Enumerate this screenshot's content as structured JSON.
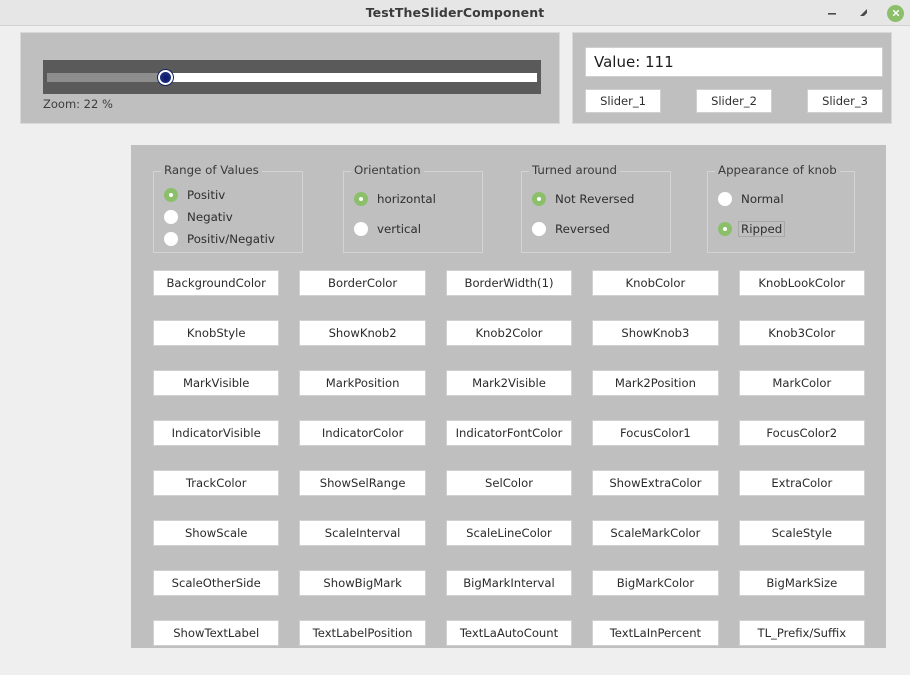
{
  "window": {
    "title": "TestTheSliderComponent",
    "controls": {
      "minimize": "minimize-icon",
      "maximize": "maximize-icon",
      "close": "close-icon"
    }
  },
  "slider_panel": {
    "zoom_label": "Zoom:  22  %",
    "zoom_percent": 22,
    "knob_position_percent": 22,
    "orientation": "horizontal"
  },
  "value_panel": {
    "value_text": "Value: 111",
    "value": 111,
    "buttons": [
      "Slider_1",
      "Slider_2",
      "Slider_3"
    ]
  },
  "option_groups": [
    {
      "legend": "Range of Values",
      "options": [
        {
          "label": "Positiv",
          "checked": true,
          "focused": false
        },
        {
          "label": "Negativ",
          "checked": false,
          "focused": false
        },
        {
          "label": "Positiv/Negativ",
          "checked": false,
          "focused": false
        }
      ]
    },
    {
      "legend": "Orientation",
      "options": [
        {
          "label": "horizontal",
          "checked": true,
          "focused": false
        },
        {
          "label": "vertical",
          "checked": false,
          "focused": false
        }
      ]
    },
    {
      "legend": "Turned around",
      "options": [
        {
          "label": "Not Reversed",
          "checked": true,
          "focused": false
        },
        {
          "label": "Reversed",
          "checked": false,
          "focused": false
        }
      ]
    },
    {
      "legend": "Appearance of knob",
      "options": [
        {
          "label": "Normal",
          "checked": false,
          "focused": false
        },
        {
          "label": "Ripped",
          "checked": true,
          "focused": true
        }
      ]
    }
  ],
  "property_buttons": [
    "BackgroundColor",
    "BorderColor",
    "BorderWidth(1)",
    "KnobColor",
    "KnobLookColor",
    "KnobStyle",
    "ShowKnob2",
    "Knob2Color",
    "ShowKnob3",
    "Knob3Color",
    "MarkVisible",
    "MarkPosition",
    "Mark2Visible",
    "Mark2Position",
    "MarkColor",
    "IndicatorVisible",
    "IndicatorColor",
    "IndicatorFontColor",
    "FocusColor1",
    "FocusColor2",
    "TrackColor",
    "ShowSelRange",
    "SelColor",
    "ShowExtraColor",
    "ExtraColor",
    "ShowScale",
    "ScaleInterval",
    "ScaleLineColor",
    "ScaleMarkColor",
    "ScaleStyle",
    "ScaleOtherSide",
    "ShowBigMark",
    "BigMarkInterval",
    "BigMarkColor",
    "BigMarkSize",
    "ShowTextLabel",
    "TextLabelPosition",
    "TextLaAutoCount",
    "TextLaInPercent",
    "TL_Prefix/Suffix"
  ],
  "colors": {
    "window_background": "#efefef",
    "titlebar": "#e6e6e6",
    "panel_background": "#bfbfbf",
    "slider_widget": "#5a5a5a",
    "slider_fill": "#8d8d8d",
    "slider_rest": "#ffffff",
    "knob": "#1a2a7a",
    "radio_checked": "#8bbf6a",
    "close_button": "#8bbf6a",
    "button_background": "#ffffff"
  }
}
